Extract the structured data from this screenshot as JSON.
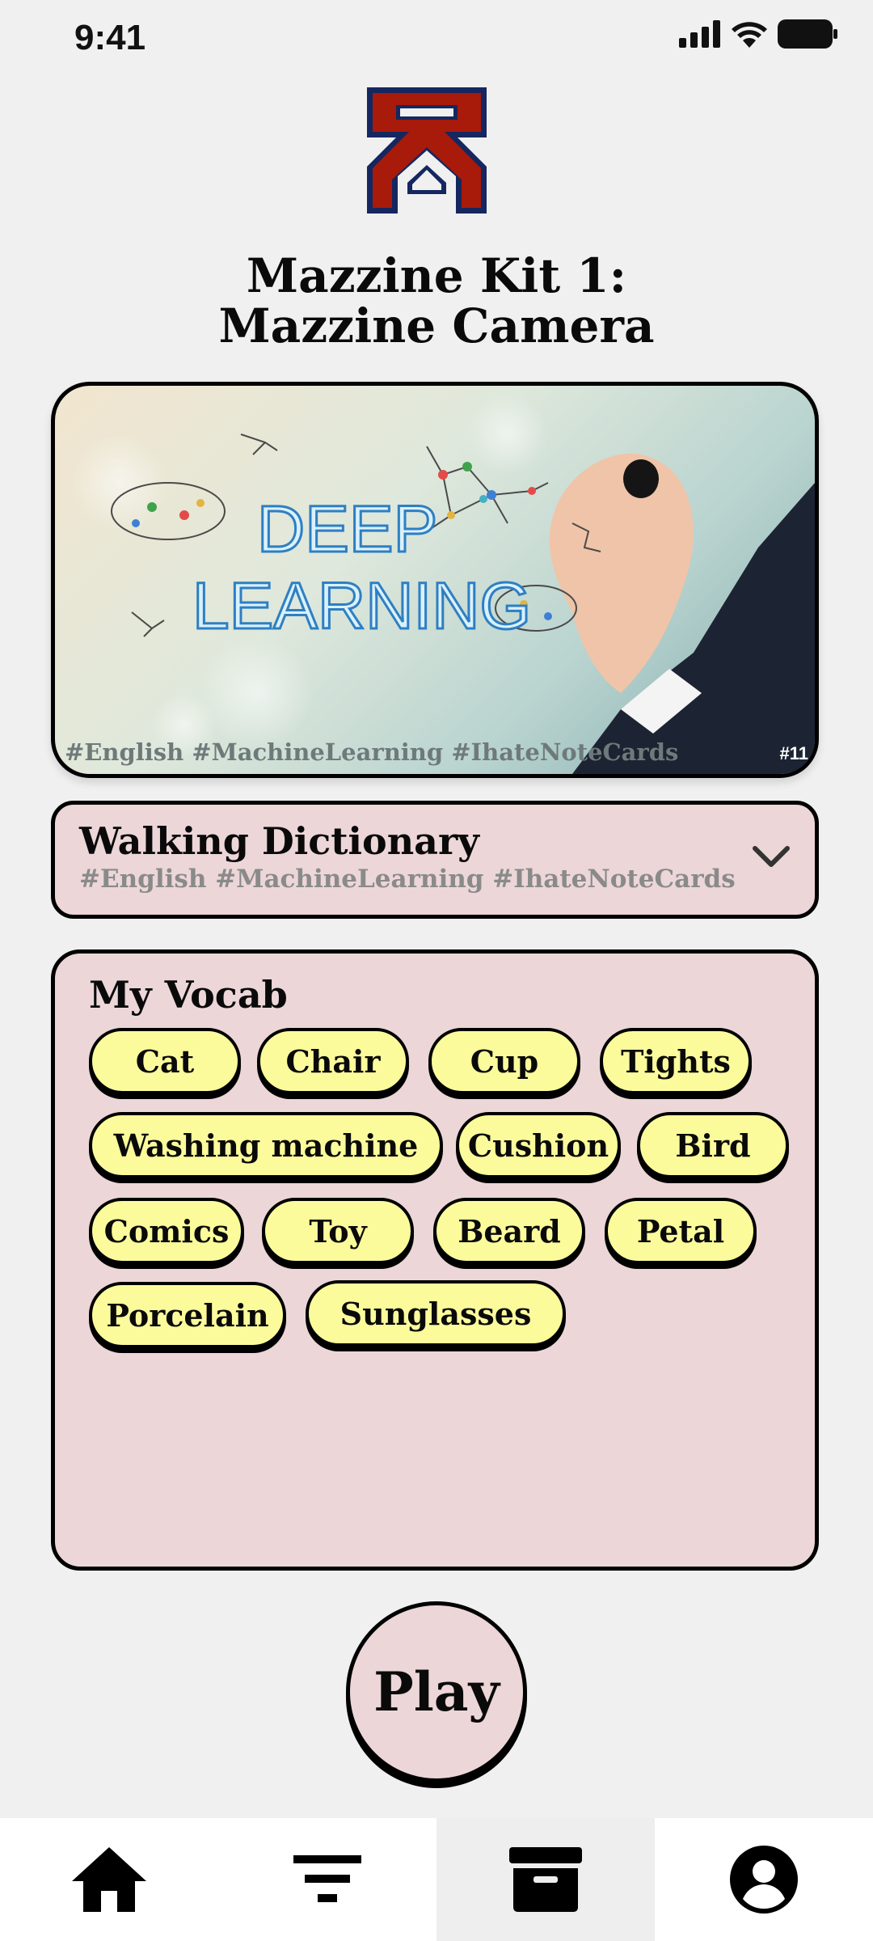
{
  "status_bar": {
    "time": "9:41",
    "icons": [
      "signal-icon",
      "wifi-icon",
      "battery-icon"
    ]
  },
  "header": {
    "logo": "app-logo",
    "title_line1": "Mazzine Kit 1:",
    "title_line2": "Mazzine Camera"
  },
  "hero": {
    "image_words": [
      "DEEP",
      "LEARNING"
    ],
    "tags": "#English #MachineLearning #IhateNoteCards",
    "id_fragment": "#11"
  },
  "deck": {
    "name": "Walking Dictionary",
    "tags": "#English #MachineLearning #IhateNoteCards",
    "icon": "chevron-down-icon"
  },
  "vocab": {
    "title": "My Vocab",
    "words": [
      "Cat",
      "Chair",
      "Cup",
      "Tights",
      "Washing machine",
      "Cushion",
      "Bird",
      "Comics",
      "Toy",
      "Beard",
      "Petal",
      "Porcelain",
      "Sunglasses"
    ]
  },
  "play_label": "Play",
  "tabs": [
    {
      "icon": "home-icon",
      "active": false
    },
    {
      "icon": "filter-icon",
      "active": false
    },
    {
      "icon": "archive-icon",
      "active": true
    },
    {
      "icon": "account-icon",
      "active": false
    }
  ],
  "colors": {
    "background": "#f0f0f0",
    "card": "#ecd6d8",
    "chip": "#fbfb9c",
    "logo_red": "#a81a0a",
    "logo_navy": "#152760"
  }
}
